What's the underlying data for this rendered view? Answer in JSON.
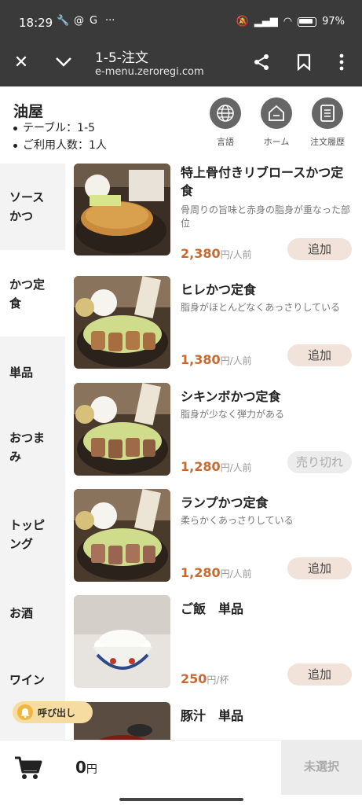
{
  "status": {
    "time": "18:29",
    "battery": "97"
  },
  "browser": {
    "title": "1-5-注文",
    "url": "e-menu.zeroregi.com"
  },
  "shop": {
    "name": "油屋",
    "table": "テーブル：1-5",
    "guests": "ご利用人数：1人"
  },
  "header_buttons": {
    "language": "言語",
    "home": "ホーム",
    "history": "注文履歴"
  },
  "categories": [
    "ソース\nかつ",
    "かつ定\n食",
    "単品",
    "おつま\nみ",
    "トッピ\nング",
    "お酒",
    "ワイン"
  ],
  "items": [
    {
      "name": "特上骨付きリブロースかつ定食",
      "desc": "骨周りの旨味と赤身の脂身が重なった部位",
      "price": "2,380",
      "unit": "円/人前",
      "button": "追加"
    },
    {
      "name": "ヒレかつ定食",
      "desc": "脂身がほとんどなくあっさりしている",
      "price": "1,380",
      "unit": "円/人前",
      "button": "追加"
    },
    {
      "name": "シキンボかつ定食",
      "desc": "脂身が少なく弾力がある",
      "price": "1,280",
      "unit": "円/人前",
      "button": "売り切れ"
    },
    {
      "name": "ランプかつ定食",
      "desc": "柔らかくあっさりしている",
      "price": "1,280",
      "unit": "円/人前",
      "button": "追加"
    },
    {
      "name": "ご飯　単品",
      "desc": "",
      "price": "250",
      "unit": "円/杯",
      "button": "追加"
    },
    {
      "name": "豚汁　単品",
      "desc": "",
      "price": "",
      "unit": "",
      "button": ""
    }
  ],
  "call_button": "呼び出し",
  "cart": {
    "total": "0",
    "yen": "円",
    "submit": "未選択"
  },
  "colors": {
    "bar": "#3a3a3a",
    "price": "#c76a32",
    "add_button": "#f2e3da",
    "sidebar": "#f3f3f3"
  }
}
